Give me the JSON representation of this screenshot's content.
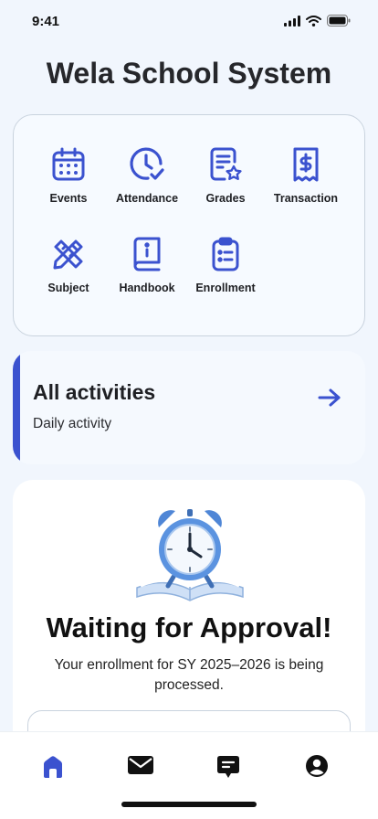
{
  "status_bar": {
    "time": "9:41"
  },
  "app": {
    "title": "Wela School System"
  },
  "menu": {
    "items": [
      {
        "label": "Events",
        "icon": "calendar-icon"
      },
      {
        "label": "Attendance",
        "icon": "clock-check-icon"
      },
      {
        "label": "Grades",
        "icon": "report-star-icon"
      },
      {
        "label": "Transaction",
        "icon": "receipt-dollar-icon"
      },
      {
        "label": "Subject",
        "icon": "ruler-pencil-icon"
      },
      {
        "label": "Handbook",
        "icon": "book-icon"
      },
      {
        "label": "Enrollment",
        "icon": "clipboard-list-icon"
      }
    ]
  },
  "activity": {
    "title": "All activities",
    "subtitle": "Daily activity"
  },
  "approval": {
    "title": "Waiting for Approval!",
    "message": "Your enrollment for SY 2025–2026 is being processed."
  },
  "bottom_nav": {
    "items": [
      {
        "icon": "home-icon",
        "active": true
      },
      {
        "icon": "mail-icon",
        "active": false
      },
      {
        "icon": "chat-icon",
        "active": false
      },
      {
        "icon": "profile-icon",
        "active": false
      }
    ]
  },
  "colors": {
    "accent": "#3b52cf",
    "background": "#f1f6fd",
    "text": "#1f2024"
  }
}
